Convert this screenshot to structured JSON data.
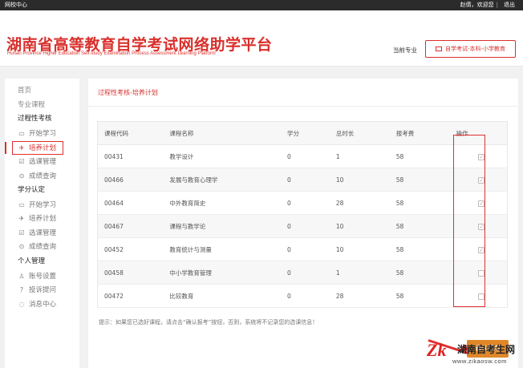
{
  "topbar": {
    "left_label": "网校中心",
    "user_greeting": "赵倩，欢迎您",
    "separator": "|",
    "logout_label": "退出"
  },
  "header": {
    "title": "湖南省高等教育自学考试网络助学平台",
    "subtitle": "Hunan Province Higher Education Self-study Examination Process Assessment Learning Platform",
    "current_major_label": "当前专业",
    "current_major_value": "自学考试-本科-小学教育"
  },
  "sidebar": {
    "home": "首页",
    "courses": "专业课程",
    "section1": {
      "title": "过程性考核",
      "items": [
        {
          "label": "开始学习",
          "icon": "monitor-icon"
        },
        {
          "label": "培养计划",
          "icon": "rocket-icon"
        },
        {
          "label": "选课管理",
          "icon": "checkbox-icon"
        },
        {
          "label": "成绩查询",
          "icon": "search-icon"
        }
      ]
    },
    "section2": {
      "title": "学分认定",
      "items": [
        {
          "label": "开始学习",
          "icon": "monitor-icon"
        },
        {
          "label": "培养计划",
          "icon": "rocket-icon"
        },
        {
          "label": "选课管理",
          "icon": "checkbox-icon"
        },
        {
          "label": "成绩查询",
          "icon": "search-icon"
        }
      ]
    },
    "section3": {
      "title": "个人管理",
      "items": [
        {
          "label": "账号设置",
          "icon": "user-icon"
        },
        {
          "label": "投诉提问",
          "icon": "question-icon"
        },
        {
          "label": "消息中心",
          "icon": "message-icon"
        }
      ]
    }
  },
  "main": {
    "breadcrumb": "过程性考核-培养计划",
    "table": {
      "headers": [
        "课程代码",
        "课程名称",
        "学分",
        "总时长",
        "报考费",
        "操作"
      ],
      "rows": [
        {
          "code": "00431",
          "name": "教学设计",
          "credit": "0",
          "hours": "1",
          "fee": "58",
          "checked": true
        },
        {
          "code": "00466",
          "name": "发展与教育心理学",
          "credit": "0",
          "hours": "10",
          "fee": "58",
          "checked": true
        },
        {
          "code": "00464",
          "name": "中外教育简史",
          "credit": "0",
          "hours": "28",
          "fee": "58",
          "checked": true
        },
        {
          "code": "00467",
          "name": "课程与教学论",
          "credit": "0",
          "hours": "10",
          "fee": "58",
          "checked": true
        },
        {
          "code": "00452",
          "name": "教育统计与测量",
          "credit": "0",
          "hours": "10",
          "fee": "58",
          "checked": true
        },
        {
          "code": "00458",
          "name": "中小学教育管理",
          "credit": "0",
          "hours": "1",
          "fee": "58",
          "checked": false
        },
        {
          "code": "00472",
          "name": "比较教育",
          "credit": "0",
          "hours": "28",
          "fee": "58",
          "checked": false
        }
      ]
    },
    "tip": "提示：如果您已选好课程，请点击“确认报考”按钮，否则，系统将不记录您的选课信息！",
    "confirm_label": "确认报考"
  },
  "watermark": {
    "logo": "Zk",
    "name": "湖南自考生网",
    "url": "www.zikaosw.com"
  },
  "colors": {
    "brand_red": "#d9302c",
    "topbar_bg": "#2b2b2b",
    "confirm_orange": "#e0872a"
  }
}
